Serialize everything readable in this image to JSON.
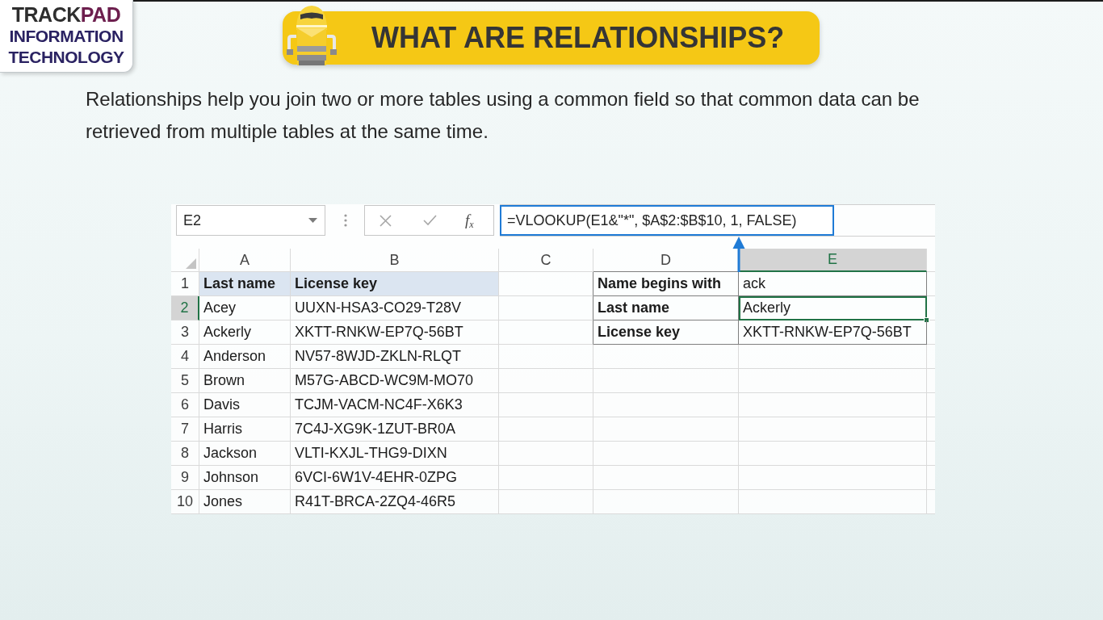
{
  "logo": {
    "brand": "TRACK**PAD**",
    "tagline": "INFORMATION TECHNOLOGY"
  },
  "banner": {
    "title": "WHAT ARE RELATIONSHIPS?"
  },
  "intro": "Relationships help you join two or more tables using a common field so that common data can be retrieved from multiple tables at the same time.",
  "spreadsheet": {
    "name_box": "E2",
    "function_label": "f$_{x}$",
    "formula": "=VLOOKUP(E1&\"*\", $A$2:$B$10, 1, FALSE)",
    "columns": [
      {
        "label": "A",
        "selected": false
      },
      {
        "label": "B",
        "selected": false
      },
      {
        "label": "C",
        "selected": false
      },
      {
        "label": "D",
        "selected": false
      },
      {
        "label": "E",
        "selected": true
      }
    ],
    "rows": [
      {
        "number": "1",
        "selected": false
      },
      {
        "number": "2",
        "selected": true
      },
      {
        "number": "3",
        "selected": false
      },
      {
        "number": "4",
        "selected": false
      },
      {
        "number": "5",
        "selected": false
      },
      {
        "number": "6",
        "selected": false
      },
      {
        "number": "7",
        "selected": false
      },
      {
        "number": "8",
        "selected": false
      },
      {
        "number": "9",
        "selected": false
      },
      {
        "number": "10",
        "selected": false
      }
    ],
    "name_table": {
      "columns": [
        "Last name",
        "License key"
      ],
      "rows": [
        [
          "Acey",
          "UUXN-HSA3-CO29-T28V"
        ],
        [
          "Ackerly",
          "XKTT-RNKW-EP7Q-56BT"
        ],
        [
          "Anderson",
          "NV57-8WJD-ZKLN-RLQT"
        ],
        [
          "Brown",
          "M57G-ABCD-WC9M-MO70"
        ],
        [
          "Davis",
          "TCJM-VACM-NC4F-X6K3"
        ],
        [
          "Harris",
          "7C4J-XG9K-1ZUT-BR0A"
        ],
        [
          "Jackson",
          "VLTI-KXJL-THG9-DIXN"
        ],
        [
          "Johnson",
          "6VCI-6W1V-4EHR-0ZPG"
        ],
        [
          "Jones",
          "R41T-BRCA-2ZQ4-46R5"
        ]
      ]
    },
    "lookup_table": {
      "rows": [
        {
          "label": "Name begins with",
          "value": "ack",
          "selected": false
        },
        {
          "label": "Last name",
          "value": "Ackerly",
          "selected": true
        },
        {
          "label": "License key",
          "value": "XKTT-RNKW-EP7Q-56BT",
          "selected": false
        }
      ]
    }
  }
}
